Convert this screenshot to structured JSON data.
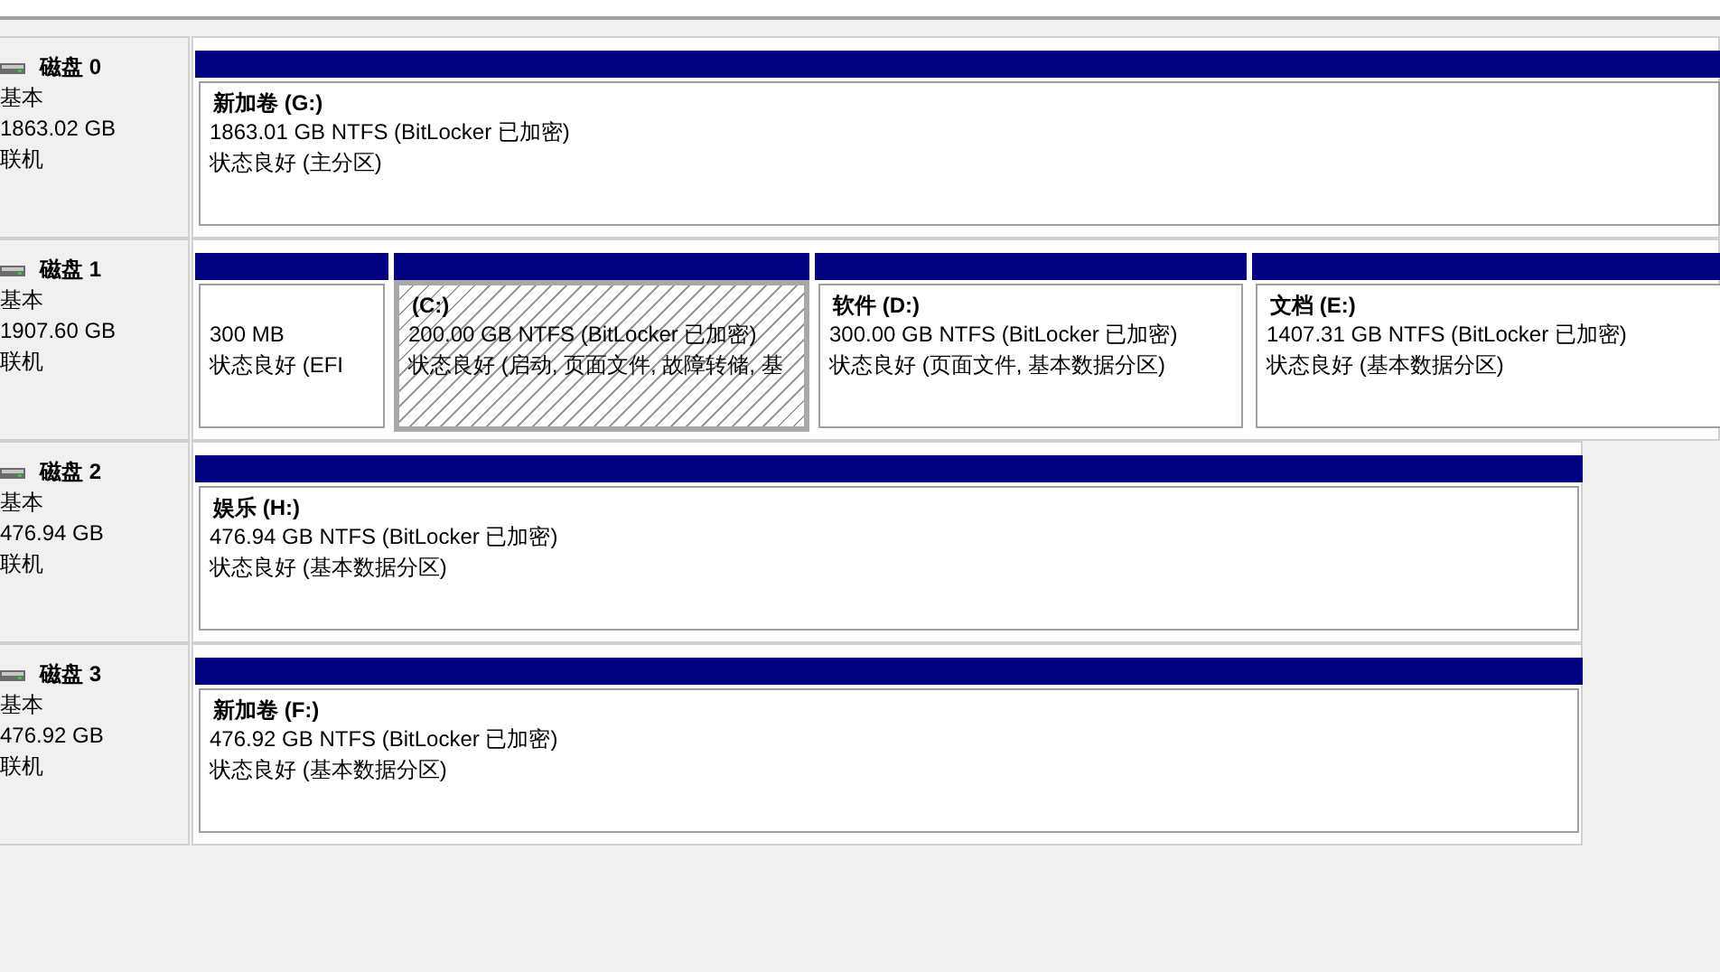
{
  "disks": [
    {
      "name": "磁盘 0",
      "type": "基本",
      "size": "1863.02 GB",
      "status": "联机",
      "partitions": [
        {
          "label": "新加卷 (G:)",
          "info": "1863.01 GB NTFS (BitLocker 已加密)",
          "status": "状态良好 (主分区)",
          "selected": false
        }
      ]
    },
    {
      "name": "磁盘 1",
      "type": "基本",
      "size": "1907.60 GB",
      "status": "联机",
      "partitions": [
        {
          "info": "300 MB",
          "status": "状态良好 (EFI",
          "selected": false
        },
        {
          "label": "(C:)",
          "info": "200.00 GB NTFS (BitLocker 已加密)",
          "status": "状态良好 (启动, 页面文件, 故障转储, 基",
          "selected": true
        },
        {
          "label": "软件 (D:)",
          "info": "300.00 GB NTFS (BitLocker 已加密)",
          "status": "状态良好 (页面文件, 基本数据分区)",
          "selected": false
        },
        {
          "label": "文档 (E:)",
          "info": "1407.31 GB NTFS (BitLocker 已加密)",
          "status": "状态良好 (基本数据分区)",
          "selected": false
        }
      ]
    },
    {
      "name": "磁盘 2",
      "type": "基本",
      "size": "476.94 GB",
      "status": "联机",
      "partitions": [
        {
          "label": "娱乐 (H:)",
          "info": "476.94 GB NTFS (BitLocker 已加密)",
          "status": "状态良好 (基本数据分区)",
          "selected": false
        }
      ]
    },
    {
      "name": "磁盘 3",
      "type": "基本",
      "size": "476.92 GB",
      "status": "联机",
      "partitions": [
        {
          "label": "新加卷 (F:)",
          "info": "476.92 GB NTFS (BitLocker 已加密)",
          "status": "状态良好 (基本数据分区)",
          "selected": false
        }
      ]
    }
  ]
}
